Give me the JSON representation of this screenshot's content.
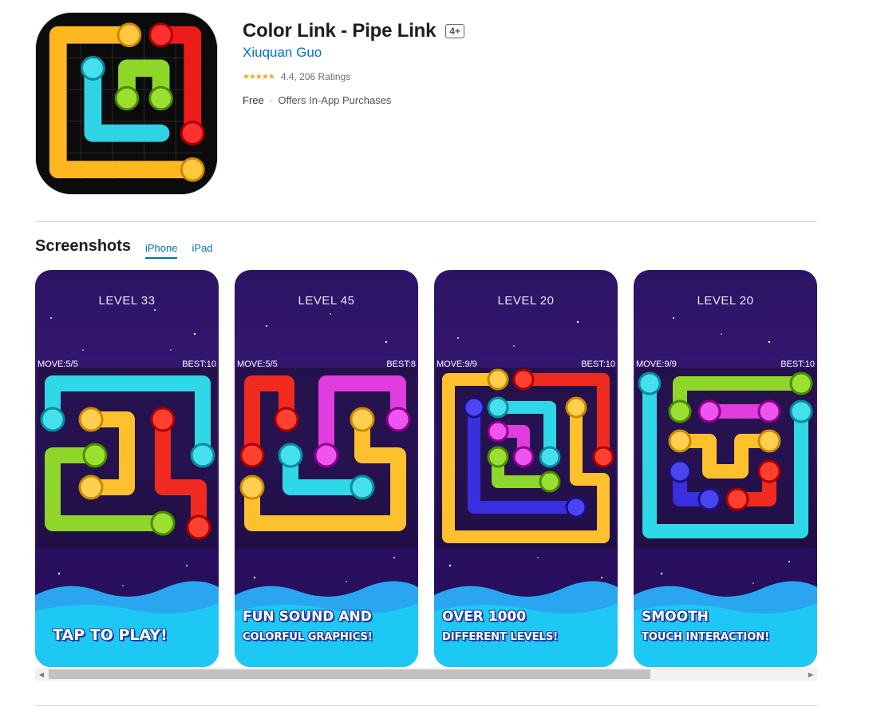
{
  "app": {
    "title": "Color Link - Pipe Link",
    "age_rating": "4+",
    "developer": "Xiuquan Guo",
    "stars": "★★★★★",
    "rating_text": "4.4, 206 Ratings",
    "price": "Free",
    "separator": "·",
    "iap": "Offers In-App Purchases"
  },
  "screenshots_section": {
    "title": "Screenshots",
    "tabs": [
      {
        "label": "iPhone",
        "active": true
      },
      {
        "label": "iPad",
        "active": false
      }
    ],
    "shots": [
      {
        "level": "LEVEL 33",
        "move": "MOVE:5/5",
        "best": "BEST:10",
        "caption_line1": "TAP TO PLAY!",
        "caption_line2": ""
      },
      {
        "level": "LEVEL 45",
        "move": "MOVE:5/5",
        "best": "BEST:8",
        "caption_line1": "FUN SOUND AND",
        "caption_line2": "COLORFUL GRAPHICS!"
      },
      {
        "level": "LEVEL 20",
        "move": "MOVE:9/9",
        "best": "BEST:10",
        "caption_line1": "OVER 1000",
        "caption_line2": "DIFFERENT LEVELS!"
      },
      {
        "level": "LEVEL 20",
        "move": "MOVE:9/9",
        "best": "BEST:10",
        "caption_line1": "SMOOTH",
        "caption_line2": "TOUCH INTERACTION!"
      }
    ]
  },
  "colors": {
    "link": "#0070c9",
    "star": "#f5a623",
    "pipe_cyan": "#2fd8e6",
    "pipe_yellow": "#ffc02e",
    "pipe_red": "#f02a1e",
    "pipe_green": "#8fd62a",
    "pipe_magenta": "#e03ce0",
    "pipe_blue": "#3a2fe0"
  },
  "scrollbar": {
    "left_arrow": "◀",
    "right_arrow": "▶"
  }
}
